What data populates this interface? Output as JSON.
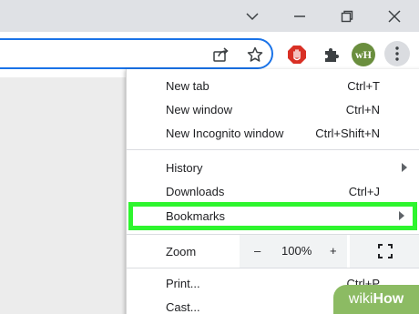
{
  "window_controls": {
    "chevron": "chevron-down-icon",
    "minimize": "minimize-icon",
    "restore": "restore-icon",
    "close": "close-icon"
  },
  "toolbar": {
    "share_icon": "share-icon",
    "star_icon": "star-icon",
    "extension_adblock": "stop-hand-icon",
    "extensions_icon": "puzzle-icon",
    "profile_text": "wH",
    "menu_icon": "kebab-menu-icon"
  },
  "menu": {
    "new_tab": {
      "label": "New tab",
      "shortcut": "Ctrl+T"
    },
    "new_window": {
      "label": "New window",
      "shortcut": "Ctrl+N"
    },
    "incognito": {
      "label": "New Incognito window",
      "shortcut": "Ctrl+Shift+N"
    },
    "history": {
      "label": "History"
    },
    "downloads": {
      "label": "Downloads",
      "shortcut": "Ctrl+J"
    },
    "bookmarks": {
      "label": "Bookmarks"
    },
    "zoom": {
      "label": "Zoom",
      "minus": "–",
      "value": "100%",
      "plus": "+"
    },
    "print": {
      "label": "Print...",
      "shortcut": "Ctrl+P"
    },
    "cast": {
      "label": "Cast..."
    }
  },
  "watermark": {
    "prefix": "wiki",
    "suffix": "How"
  },
  "colors": {
    "accent": "#1a73e8",
    "highlight": "#2ef52e",
    "watermark": "#8cbb63"
  }
}
